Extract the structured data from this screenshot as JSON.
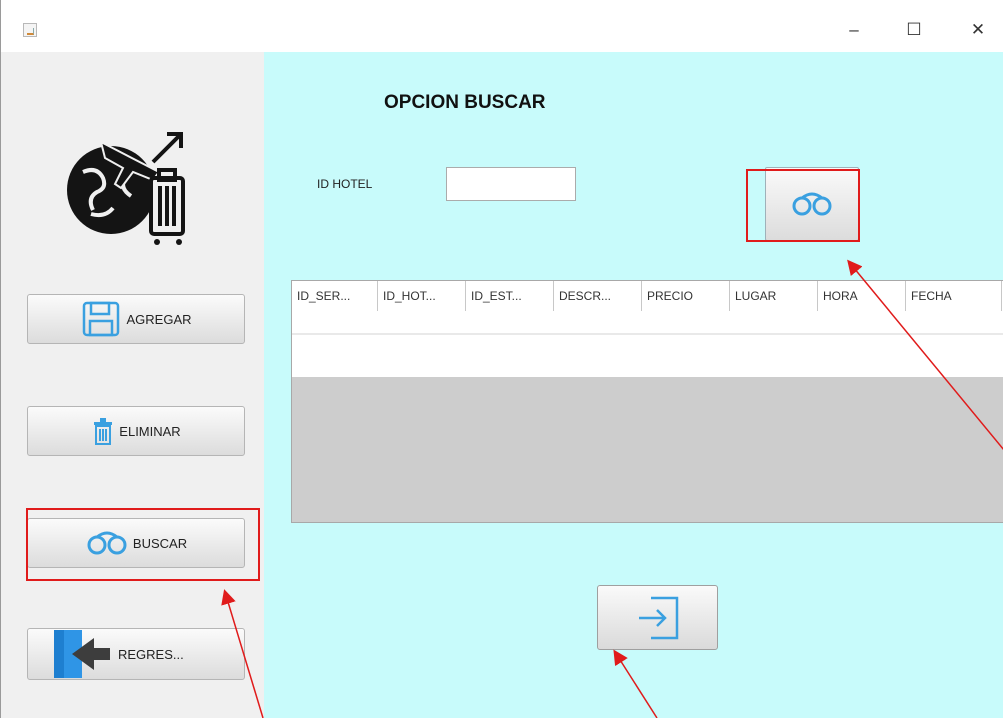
{
  "window": {
    "controls": {
      "minimize": "–",
      "maximize": "☐",
      "close": "✕"
    }
  },
  "sidebar": {
    "buttons": [
      {
        "label": "AGREGAR",
        "icon": "save-icon"
      },
      {
        "label": "ELIMINAR",
        "icon": "trash-icon"
      },
      {
        "label": "BUSCAR",
        "icon": "binoculars-icon"
      },
      {
        "label": "REGRES...",
        "icon": "arrow-return-icon"
      }
    ]
  },
  "main": {
    "title": "OPCION BUSCAR",
    "id_label": "ID HOTEL",
    "id_value": "",
    "table": {
      "columns": [
        "ID_SER...",
        "ID_HOT...",
        "ID_EST...",
        "DESCR...",
        "PRECIO",
        "LUGAR",
        "HORA",
        "FECHA"
      ],
      "rows": []
    }
  },
  "colors": {
    "panel_bg": "#c8fbfb",
    "accent_icon": "#3aa0e0",
    "highlight": "#e01b1b"
  }
}
